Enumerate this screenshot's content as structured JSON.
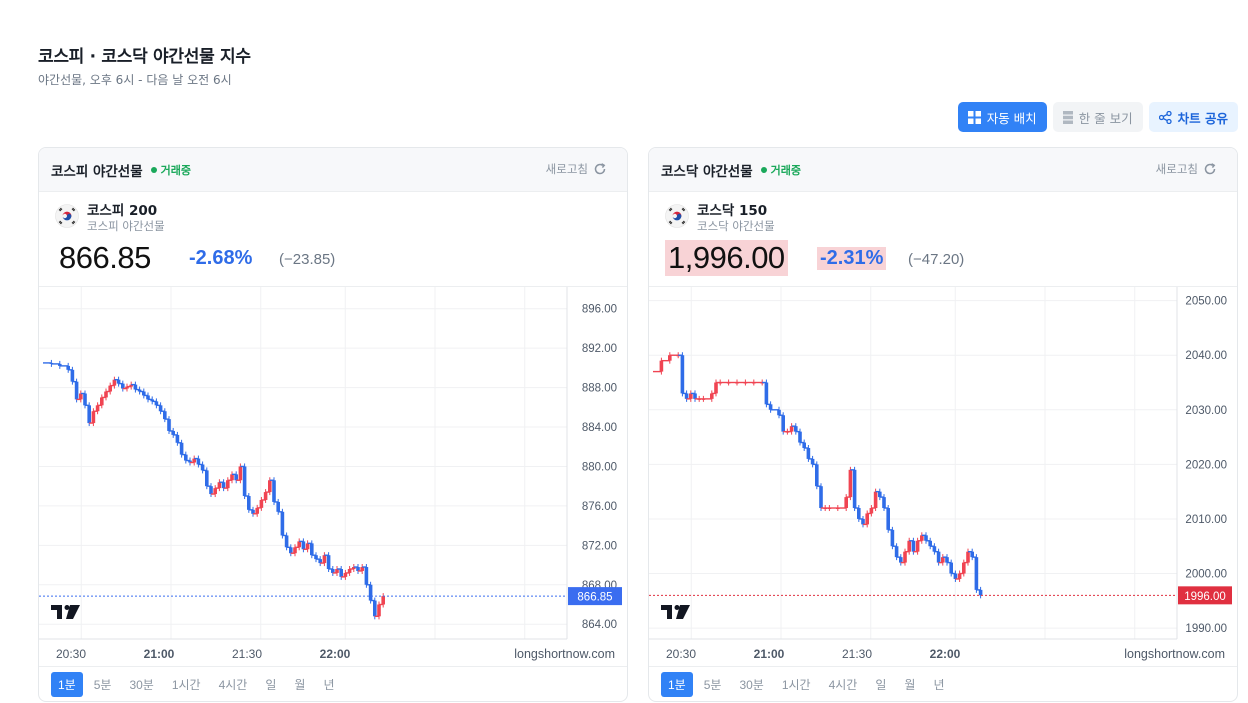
{
  "page": {
    "title": "코스피 · 코스닥 야간선물 지수",
    "subtitle": "야간선물, 오후 6시 - 다음 날 오전 6시"
  },
  "toolbar": {
    "auto_layout": "자동 배치",
    "single_row": "한 줄 보기",
    "share": "차트 공유"
  },
  "colors": {
    "accent": "#3182f6",
    "up": "#f04452",
    "down": "#2f6ce8",
    "status": "#1aa85a"
  },
  "timeframes": [
    "1분",
    "5분",
    "30분",
    "1시간",
    "4시간",
    "일",
    "월",
    "년"
  ],
  "cards": [
    {
      "title": "코스피 야간선물",
      "status": "거래중",
      "refresh": "새로고침",
      "instrument": "코스피 200",
      "instrument_sub": "코스피 야간선물",
      "price": "866.85",
      "change_pct": "-2.68%",
      "change_abs": "(−23.85)",
      "price_tag": "866.85",
      "watermark": "longshortnow.com",
      "x_ticks": [
        "20:30",
        "21:00",
        "21:30",
        "22:00"
      ],
      "y_ticks": [
        "896.00",
        "892.00",
        "888.00",
        "884.00",
        "880.00",
        "876.00",
        "872.00",
        "868.00",
        "864.00"
      ]
    },
    {
      "title": "코스닥 야간선물",
      "status": "거래중",
      "refresh": "새로고침",
      "instrument": "코스닥 150",
      "instrument_sub": "코스닥 야간선물",
      "price": "1,996.00",
      "change_pct": "-2.31%",
      "change_abs": "(−47.20)",
      "price_tag": "1996.00",
      "watermark": "longshortnow.com",
      "x_ticks": [
        "20:30",
        "21:00",
        "21:30",
        "22:00"
      ],
      "y_ticks": [
        "2050.00",
        "2040.00",
        "2030.00",
        "2020.00",
        "2010.00",
        "2000.00",
        "1990.00"
      ]
    }
  ],
  "chart_data": [
    {
      "type": "candlestick",
      "title": "코스피 야간선물",
      "x_ticks": [
        "20:30",
        "21:00",
        "21:30",
        "22:00"
      ],
      "ylim": [
        862.5,
        898.2
      ],
      "last": 866.85,
      "series": [
        [
          0,
          890.5
        ],
        [
          2,
          890.4
        ],
        [
          4,
          890.2
        ],
        [
          6,
          889.8
        ],
        [
          7,
          888.6
        ],
        [
          8,
          886.8
        ],
        [
          9,
          887.4
        ],
        [
          10,
          886.2
        ],
        [
          11,
          884.4
        ],
        [
          12,
          885.6
        ],
        [
          13,
          886.2
        ],
        [
          14,
          887.0
        ],
        [
          15,
          887.6
        ],
        [
          16,
          888.2
        ],
        [
          17,
          888.8
        ],
        [
          18,
          888.4
        ],
        [
          19,
          887.9
        ],
        [
          20,
          888.1
        ],
        [
          21,
          888.3
        ],
        [
          22,
          887.8
        ],
        [
          23,
          887.6
        ],
        [
          24,
          887.2
        ],
        [
          25,
          886.8
        ],
        [
          26,
          886.6
        ],
        [
          27,
          886.2
        ],
        [
          28,
          885.6
        ],
        [
          29,
          884.8
        ],
        [
          30,
          883.6
        ],
        [
          31,
          883.2
        ],
        [
          32,
          882.4
        ],
        [
          33,
          881.2
        ],
        [
          34,
          880.6
        ],
        [
          35,
          880.4
        ],
        [
          36,
          880.8
        ],
        [
          37,
          880.2
        ],
        [
          38,
          879.6
        ],
        [
          39,
          878.0
        ],
        [
          40,
          877.2
        ],
        [
          41,
          877.8
        ],
        [
          42,
          878.4
        ],
        [
          43,
          877.8
        ],
        [
          44,
          878.6
        ],
        [
          45,
          879.2
        ],
        [
          46,
          878.6
        ],
        [
          47,
          880.0
        ],
        [
          48,
          877.0
        ],
        [
          49,
          875.6
        ],
        [
          50,
          875.2
        ],
        [
          51,
          875.8
        ],
        [
          52,
          876.6
        ],
        [
          53,
          877.4
        ],
        [
          54,
          878.6
        ],
        [
          55,
          876.4
        ],
        [
          56,
          875.4
        ],
        [
          57,
          873.0
        ],
        [
          58,
          871.8
        ],
        [
          59,
          871.2
        ],
        [
          60,
          871.8
        ],
        [
          61,
          872.4
        ],
        [
          62,
          871.6
        ],
        [
          63,
          872.2
        ],
        [
          64,
          871.0
        ],
        [
          65,
          870.6
        ],
        [
          66,
          870.2
        ],
        [
          67,
          871.0
        ],
        [
          68,
          869.6
        ],
        [
          69,
          869.2
        ],
        [
          70,
          869.6
        ],
        [
          71,
          868.8
        ],
        [
          72,
          869.2
        ],
        [
          73,
          869.6
        ],
        [
          74,
          869.8
        ],
        [
          75,
          869.4
        ],
        [
          76,
          869.8
        ],
        [
          77,
          868.0
        ],
        [
          78,
          866.4
        ],
        [
          79,
          864.8
        ],
        [
          80,
          866.0
        ],
        [
          81,
          866.85
        ]
      ]
    },
    {
      "type": "candlestick",
      "title": "코스닥 야간선물",
      "x_ticks": [
        "20:30",
        "21:00",
        "21:30",
        "22:00"
      ],
      "ylim": [
        1988.0,
        2052.5
      ],
      "last": 1996.0,
      "series": [
        [
          0,
          2037
        ],
        [
          2,
          2039
        ],
        [
          4,
          2040
        ],
        [
          6,
          2040
        ],
        [
          7,
          2033
        ],
        [
          8,
          2032
        ],
        [
          9,
          2033
        ],
        [
          10,
          2032
        ],
        [
          11,
          2032
        ],
        [
          12,
          2032
        ],
        [
          14,
          2033
        ],
        [
          15,
          2035
        ],
        [
          16,
          2035
        ],
        [
          18,
          2035
        ],
        [
          20,
          2035
        ],
        [
          22,
          2035
        ],
        [
          24,
          2035
        ],
        [
          26,
          2035
        ],
        [
          27,
          2031
        ],
        [
          28,
          2030
        ],
        [
          30,
          2029
        ],
        [
          31,
          2026
        ],
        [
          32,
          2026
        ],
        [
          33,
          2027
        ],
        [
          34,
          2026
        ],
        [
          35,
          2024
        ],
        [
          36,
          2023
        ],
        [
          37,
          2021
        ],
        [
          38,
          2020
        ],
        [
          39,
          2016
        ],
        [
          40,
          2012
        ],
        [
          41,
          2012
        ],
        [
          42,
          2012
        ],
        [
          44,
          2012
        ],
        [
          46,
          2014
        ],
        [
          47,
          2019
        ],
        [
          48,
          2012
        ],
        [
          49,
          2010
        ],
        [
          50,
          2009
        ],
        [
          51,
          2011
        ],
        [
          52,
          2012
        ],
        [
          53,
          2015
        ],
        [
          54,
          2014
        ],
        [
          55,
          2012
        ],
        [
          56,
          2008
        ],
        [
          57,
          2005
        ],
        [
          58,
          2003
        ],
        [
          59,
          2002
        ],
        [
          60,
          2004
        ],
        [
          61,
          2006
        ],
        [
          62,
          2004
        ],
        [
          63,
          2006
        ],
        [
          64,
          2007
        ],
        [
          65,
          2006
        ],
        [
          66,
          2005
        ],
        [
          67,
          2004
        ],
        [
          68,
          2002
        ],
        [
          69,
          2003
        ],
        [
          70,
          2002
        ],
        [
          71,
          2000
        ],
        [
          72,
          1999
        ],
        [
          73,
          2000
        ],
        [
          74,
          2002
        ],
        [
          75,
          2004
        ],
        [
          76,
          2003
        ],
        [
          77,
          1997
        ],
        [
          78,
          1996
        ]
      ]
    }
  ]
}
